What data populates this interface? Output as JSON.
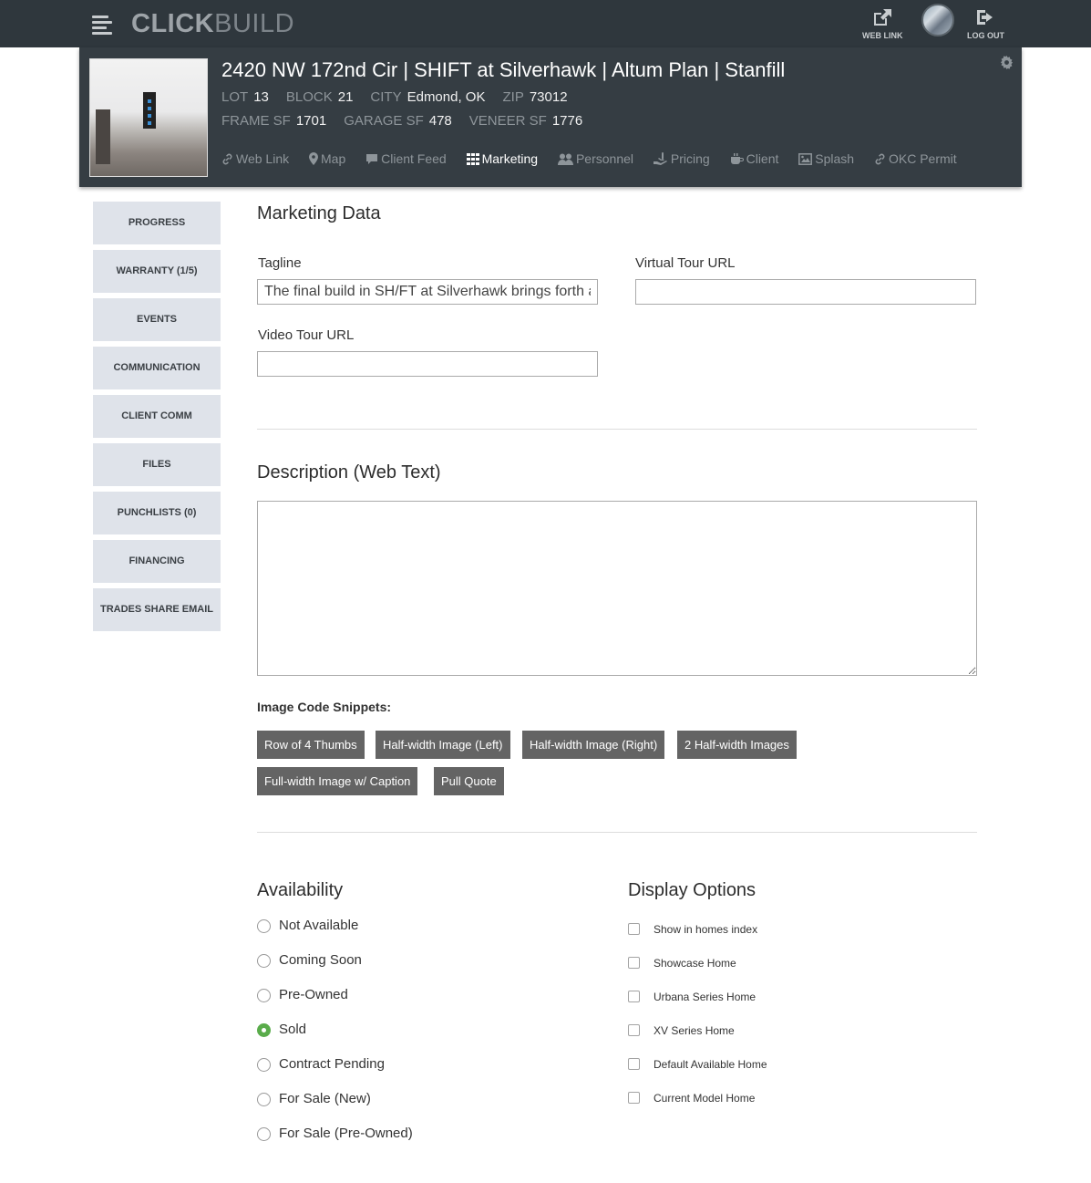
{
  "app": {
    "logo_bold": "CLICK",
    "logo_light": "BUILD",
    "web_link_label": "WEB LINK",
    "logout_label": "LOG OUT"
  },
  "project": {
    "title": "2420 NW 172nd Cir | SHIFT at Silverhawk | Altum Plan | Stanfill",
    "fields_row1": [
      {
        "key": "LOT",
        "value": "13"
      },
      {
        "key": "BLOCK",
        "value": "21"
      },
      {
        "key": "CITY",
        "value": "Edmond, OK"
      },
      {
        "key": "ZIP",
        "value": "73012"
      }
    ],
    "fields_row2": [
      {
        "key": "FRAME SF",
        "value": "1701"
      },
      {
        "key": "GARAGE SF",
        "value": "478"
      },
      {
        "key": "VENEER SF",
        "value": "1776"
      }
    ],
    "tabs": [
      {
        "label": "Web Link",
        "icon": "link-icon"
      },
      {
        "label": "Map",
        "icon": "map-marker-icon"
      },
      {
        "label": "Client Feed",
        "icon": "comment-icon"
      },
      {
        "label": "Marketing",
        "icon": "grid-icon",
        "active": true
      },
      {
        "label": "Personnel",
        "icon": "users-icon"
      },
      {
        "label": "Pricing",
        "icon": "hand-dollar-icon"
      },
      {
        "label": "Client",
        "icon": "coffee-icon"
      },
      {
        "label": "Splash",
        "icon": "image-icon"
      },
      {
        "label": "OKC Permit",
        "icon": "link-icon"
      }
    ]
  },
  "sidenav": [
    "PROGRESS",
    "WARRANTY (1/5)",
    "EVENTS",
    "COMMUNICATION",
    "CLIENT COMM",
    "FILES",
    "PUNCHLISTS (0)",
    "FINANCING",
    "TRADES SHARE EMAIL"
  ],
  "marketing": {
    "heading": "Marketing Data",
    "tagline_label": "Tagline",
    "tagline_value": "The final build in SH/FT at Silverhawk brings forth a",
    "virtual_tour_label": "Virtual Tour URL",
    "virtual_tour_value": "",
    "video_tour_label": "Video Tour URL",
    "video_tour_value": "",
    "description_heading": "Description (Web Text)",
    "description_value": "",
    "snippets_title": "Image Code Snippets:",
    "snippets": [
      "Row of 4 Thumbs",
      "Half-width Image (Left)",
      "Half-width Image (Right)",
      "2 Half-width Images",
      "Full-width Image w/ Caption",
      "Pull Quote"
    ]
  },
  "availability": {
    "heading": "Availability",
    "options": [
      "Not Available",
      "Coming Soon",
      "Pre-Owned",
      "Sold",
      "Contract Pending",
      "For Sale (New)",
      "For Sale (Pre-Owned)"
    ],
    "selected": "Sold",
    "selected_color": "#5aac4b"
  },
  "display": {
    "heading": "Display Options",
    "options": [
      "Show in homes index",
      "Showcase Home",
      "Urbana Series Home",
      "XV Series Home",
      "Default Available Home",
      "Current Model Home"
    ]
  }
}
